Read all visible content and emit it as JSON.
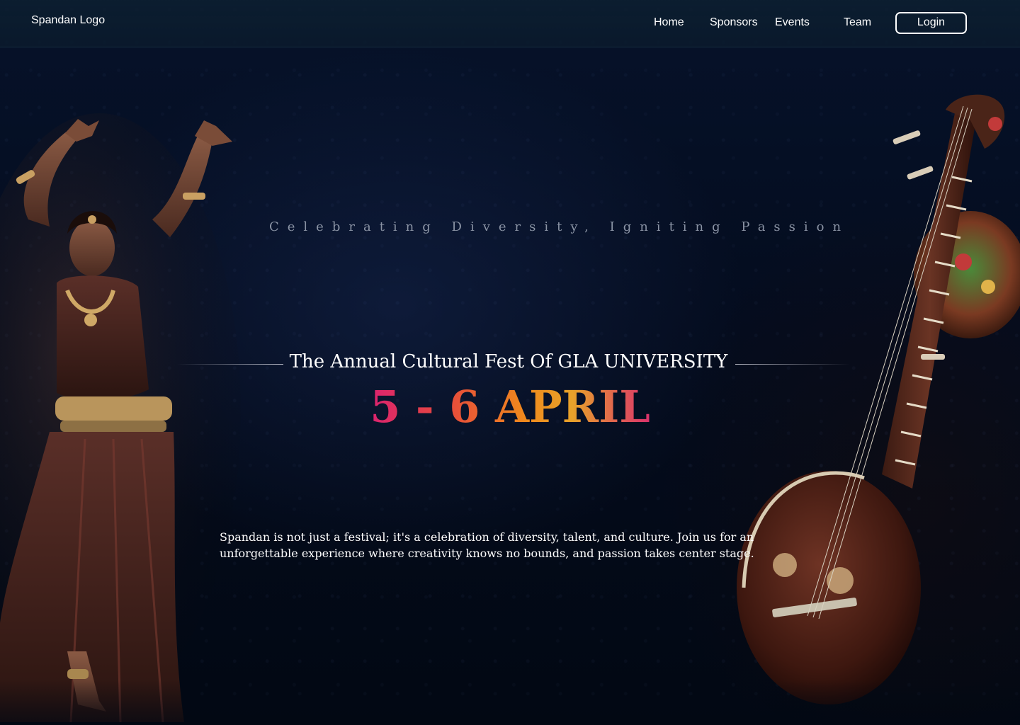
{
  "nav": {
    "logo": "Spandan Logo",
    "links": [
      "Home",
      "Sponsors",
      "Events",
      "Team"
    ],
    "login_label": "Login"
  },
  "hero": {
    "tagline": "Celebrating Diversity, Igniting Passion",
    "subtitle": "The Annual Cultural Fest Of GLA UNIVERSITY",
    "date": "5 - 6 APRIL",
    "description": "Spandan is not just a festival; it's a celebration of diversity, talent, and culture. Join us for an unforgettable experience where creativity knows no bounds, and passion takes center stage."
  },
  "icons": {
    "dancer": "dancer-illustration",
    "veena": "veena-illustration"
  },
  "colors": {
    "background": "#040c1e",
    "date_gradient": [
      "#d91b7a",
      "#e64a3c",
      "#f08a1c",
      "#e7a22a"
    ]
  }
}
